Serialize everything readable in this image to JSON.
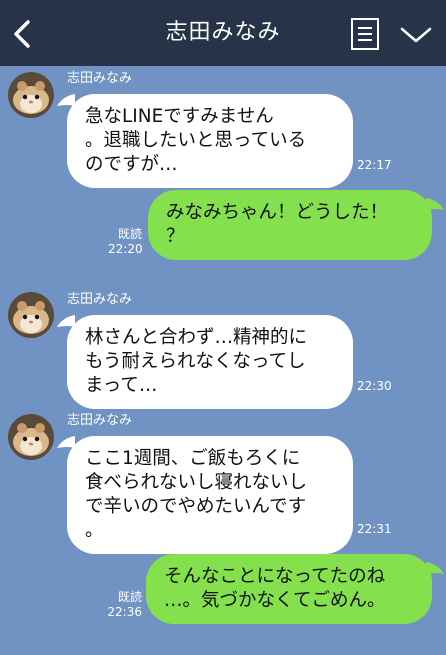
{
  "header": {
    "title": "志田みなみ",
    "back_icon": "chevron-left-icon",
    "memo_icon": "notes-icon",
    "menu_icon": "chevron-down-icon",
    "background": "#263349"
  },
  "chat_background": "#7093c4",
  "messages": [
    {
      "sender": "志田みなみ",
      "direction": "in",
      "text": "急なLINEですみません\n。退職したいと思っている\nのですが…",
      "time": "22:17"
    },
    {
      "direction": "out",
      "text": "みなみちゃん！どうした！\n？",
      "status": "既読",
      "time": "22:20"
    },
    {
      "sender": "志田みなみ",
      "direction": "in",
      "text": "林さんと合わず…精神的に\nもう耐えられなくなってし\nまって…",
      "time": "22:30"
    },
    {
      "sender": "志田みなみ",
      "direction": "in",
      "text": "ここ1週間、ご飯もろくに\n食べられないし寝れないし\nで辛いのでやめたいんです\n。",
      "time": "22:31"
    },
    {
      "direction": "out",
      "text": "そんなことになってたのね\n…。気づかなくてごめん。",
      "status": "既読",
      "time": "22:36"
    }
  ],
  "colors": {
    "incoming_bubble": "#ffffff",
    "outgoing_bubble": "#84e14d"
  }
}
